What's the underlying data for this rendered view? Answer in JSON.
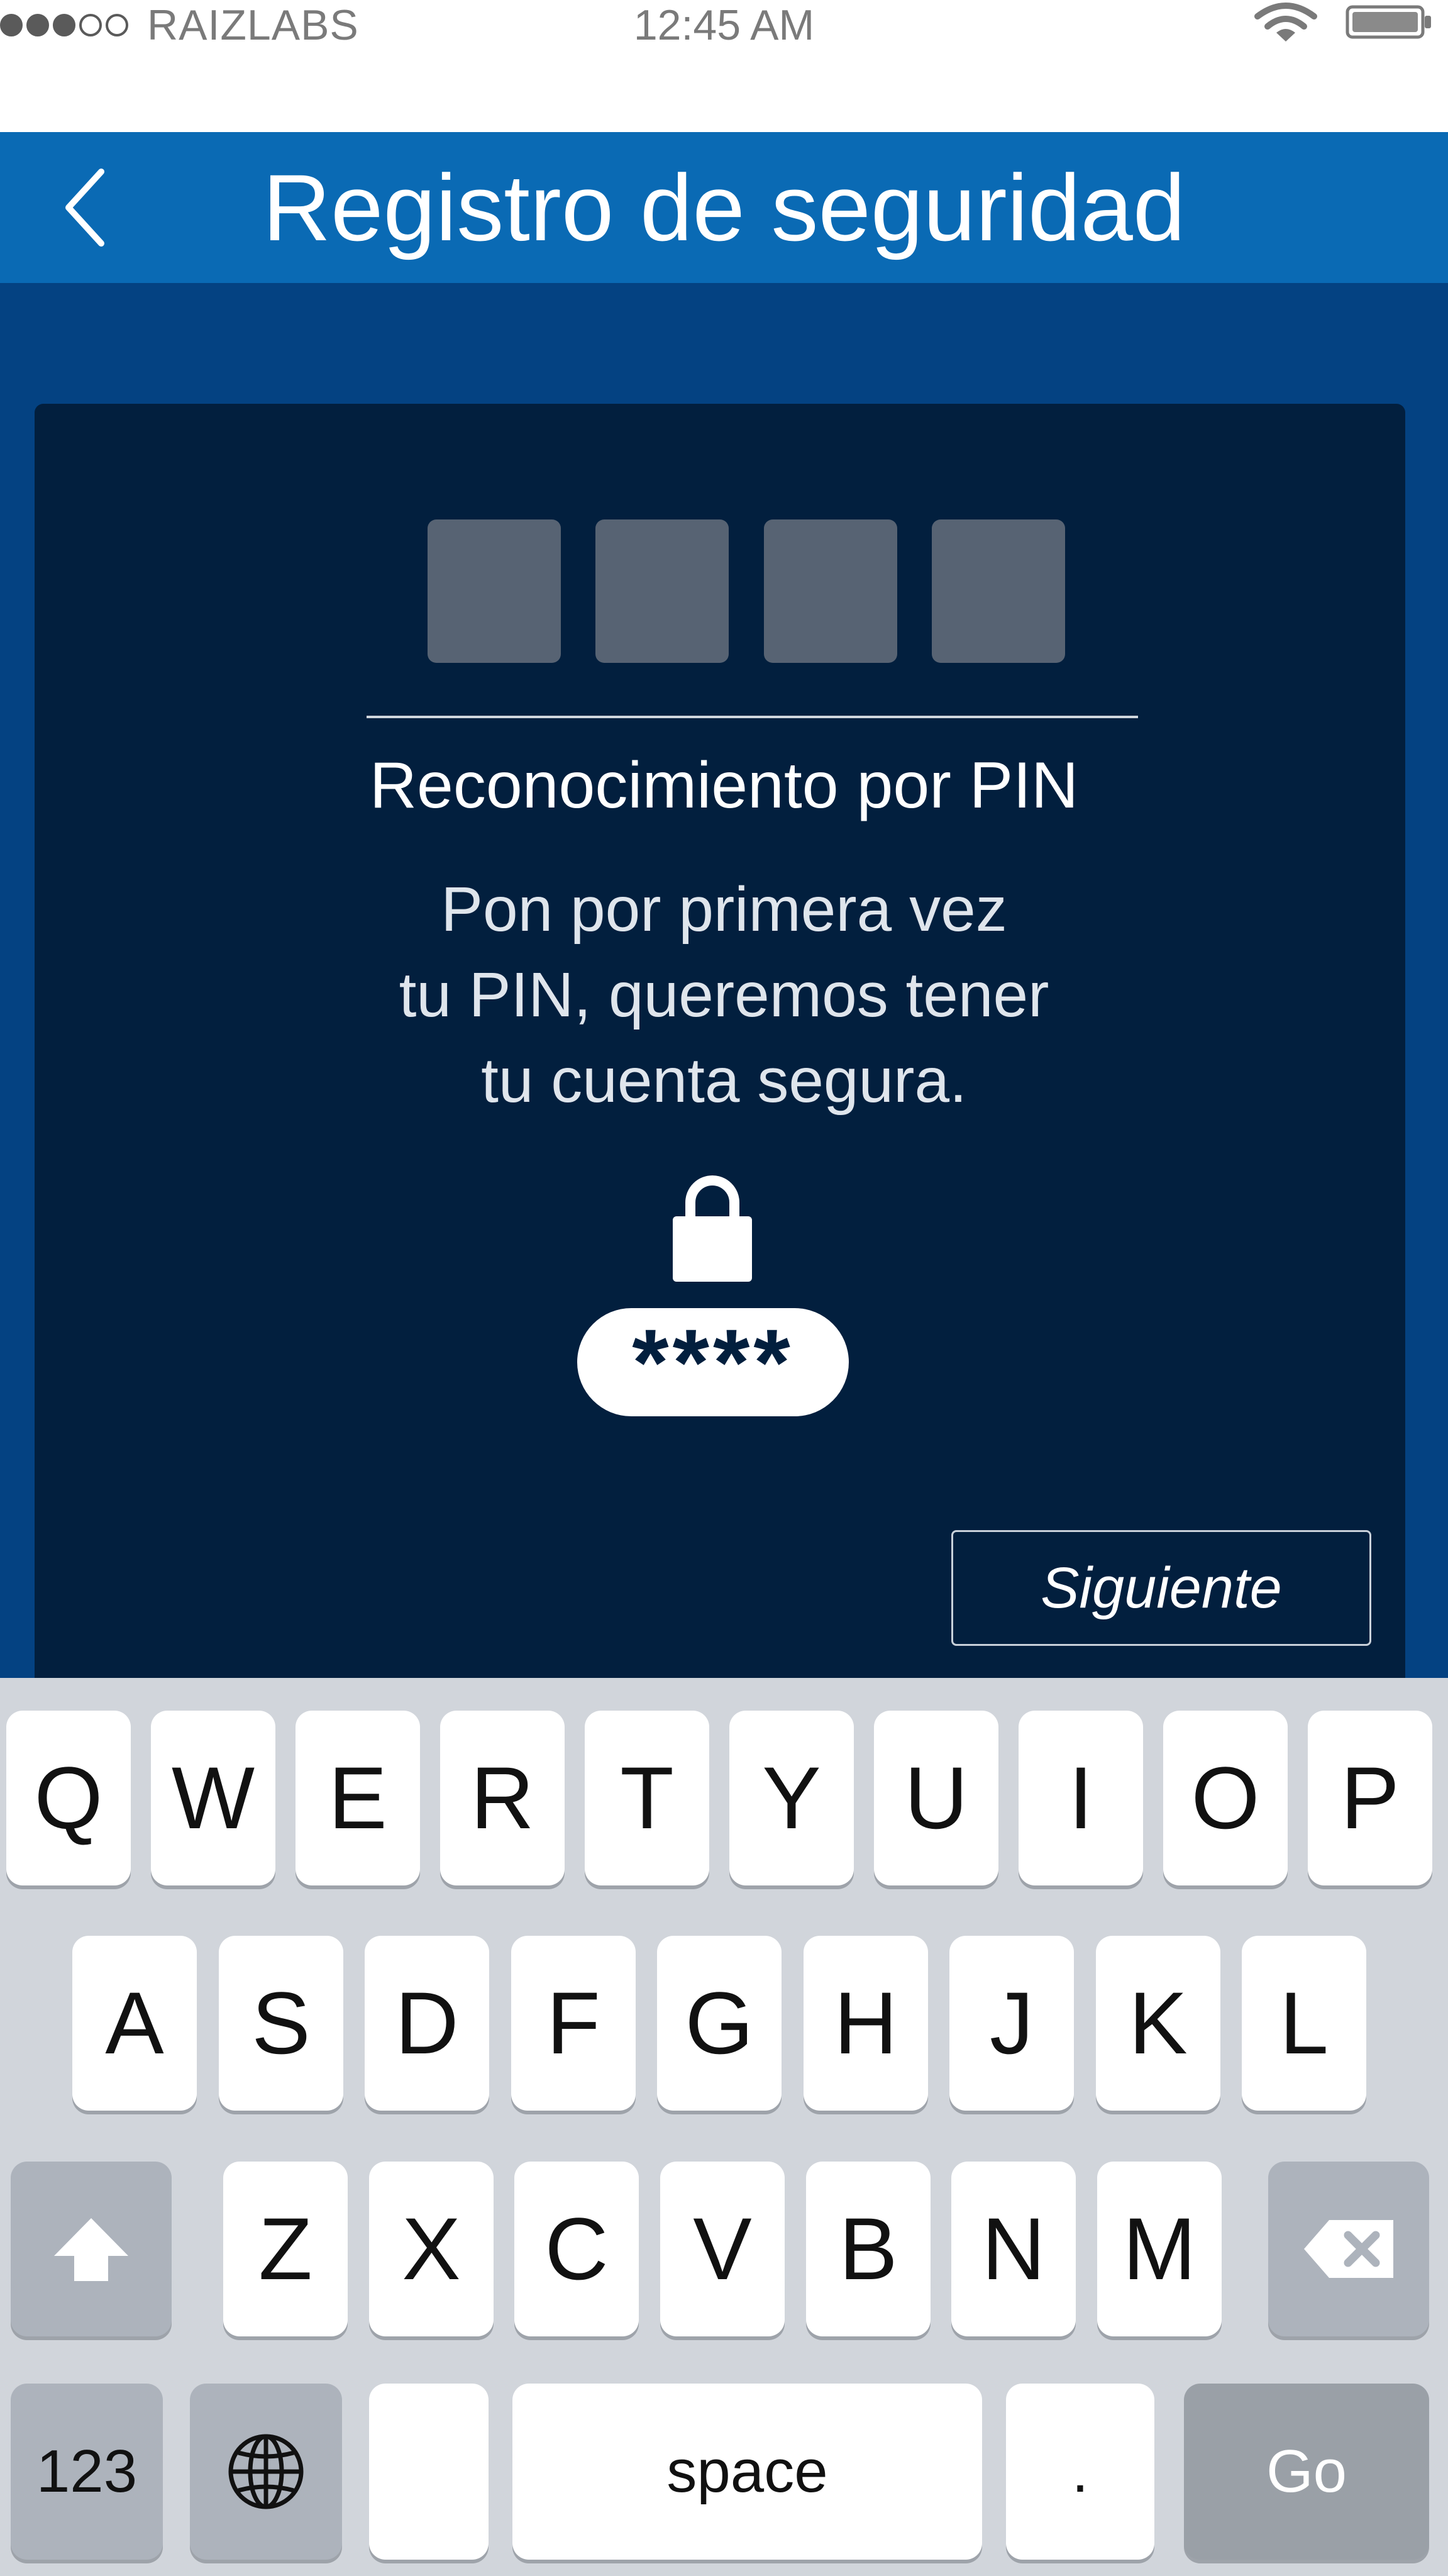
{
  "status_bar": {
    "carrier": "RAIZLABS",
    "signal_dots_filled": 3,
    "signal_dots_total": 5,
    "time": "12:45 AM",
    "wifi_icon": "wifi-icon",
    "battery_icon": "battery-icon"
  },
  "header": {
    "title": "Registro de seguridad",
    "back_icon": "chevron-left-icon",
    "background_color": "#0a6ab4"
  },
  "card": {
    "pin_box_count": 4,
    "title": "Reconocimiento por PIN",
    "description_lines": [
      "Pon por primera vez",
      "tu PIN, queremos tener",
      "tu cuenta segura."
    ],
    "lock_icon": "lock-icon",
    "pin_mask": "****",
    "next_button": "Siguiente",
    "background_color": "#021f3e"
  },
  "keyboard": {
    "row1": [
      "Q",
      "W",
      "E",
      "R",
      "T",
      "Y",
      "U",
      "I",
      "O",
      "P"
    ],
    "row2": [
      "A",
      "S",
      "D",
      "F",
      "G",
      "H",
      "J",
      "K",
      "L"
    ],
    "row3": [
      "Z",
      "X",
      "C",
      "V",
      "B",
      "N",
      "M"
    ],
    "shift_icon": "shift-icon",
    "backspace_icon": "backspace-icon",
    "numbers_key": "123",
    "globe_icon": "globe-icon",
    "space_key": "space",
    "period_key": ".",
    "go_key": "Go"
  }
}
